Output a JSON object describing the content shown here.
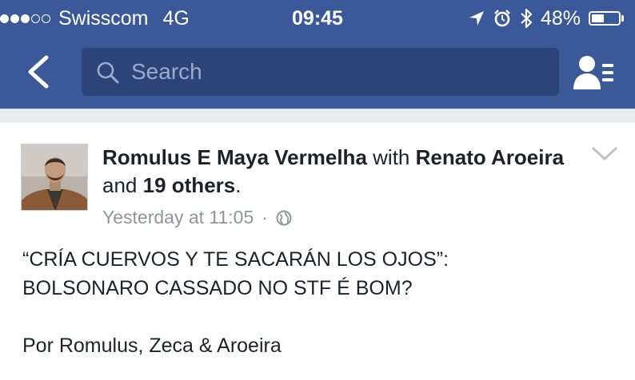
{
  "status_bar": {
    "carrier": "Swisscom",
    "network": "4G",
    "time": "09:45",
    "battery": "48%",
    "battery_level": 0.48,
    "signal_bars_filled": 3,
    "signal_bars_total": 5,
    "icons": [
      "location-arrow-icon",
      "alarm-clock-icon",
      "bluetooth-icon",
      "battery-icon"
    ]
  },
  "nav": {
    "back_icon": "chevron-left-icon",
    "search_placeholder": "Search",
    "friends_icon": "friend-requests-icon"
  },
  "post": {
    "author": "Romulus E Maya Vermelha",
    "with_word": "with",
    "tagged_name": "Renato Aroeira",
    "and_word": "and",
    "others": "19 others",
    "timestamp": "Yesterday at 11:05",
    "separator": "·",
    "privacy_icon": "globe-icon",
    "menu_icon": "chevron-down-icon",
    "text_line1": "“CRÍA CUERVOS Y TE SACARÁN LOS OJOS”:",
    "text_line2": "BOLSONARO CASSADO NO STF É BOM?",
    "text_line3": "Por Romulus, Zeca & Aroeira"
  },
  "colors": {
    "header_blue": "#3b5998",
    "search_bg": "#2c4478",
    "text_dark": "#1d2129",
    "meta_gray": "#90949c",
    "divider_gray": "#e9ebee"
  }
}
